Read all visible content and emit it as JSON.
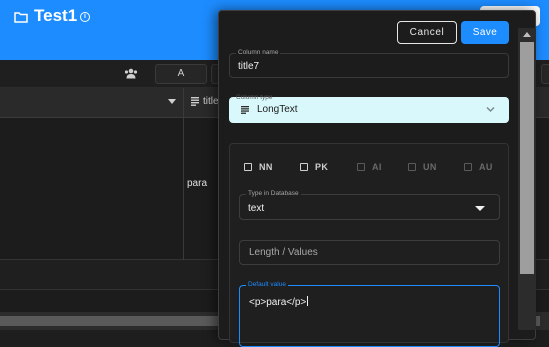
{
  "header": {
    "project_title": "Test1",
    "info_icon": "i"
  },
  "toolbar": {
    "users_icon": "users-icon",
    "button_a_label": "A"
  },
  "grid": {
    "column_name": "title7",
    "cell_value": "para"
  },
  "modal": {
    "cancel_label": "Cancel",
    "save_label": "Save",
    "column_name_legend": "Column name",
    "column_name_value": "title7",
    "column_type_legend": "Column type",
    "column_type_value": "LongText",
    "options": [
      {
        "label": "NN",
        "enabled": true
      },
      {
        "label": "PK",
        "enabled": true
      },
      {
        "label": "AI",
        "enabled": false
      },
      {
        "label": "UN",
        "enabled": false
      },
      {
        "label": "AU",
        "enabled": false
      }
    ],
    "db_type_legend": "Type in Database",
    "db_type_value": "text",
    "length_placeholder": "Length / Values",
    "default_legend": "Default value",
    "default_value": "<p>para</p>"
  },
  "colors": {
    "accent": "#1d8cff",
    "column_type_bg": "#d9f8fb",
    "background": "#1c1c1c"
  }
}
